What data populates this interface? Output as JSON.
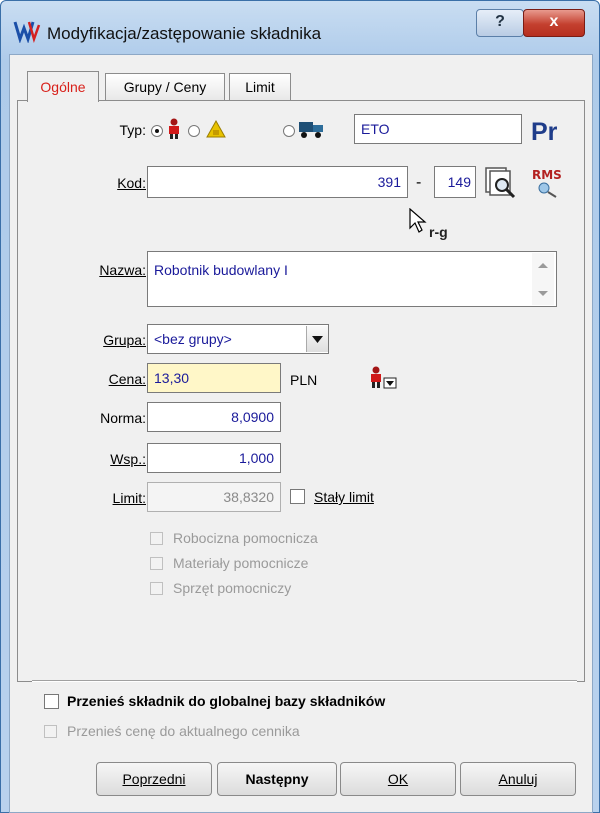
{
  "window": {
    "title": "Modyfikacja/zastępowanie składnika",
    "help": "?",
    "close": "x"
  },
  "tabs": [
    {
      "label": "Ogólne",
      "active": true
    },
    {
      "label": "Grupy / Ceny",
      "active": false
    },
    {
      "label": "Limit",
      "active": false
    }
  ],
  "form": {
    "typ_label": "Typ:",
    "typ_value": "ETO",
    "typ_badge": "Pr",
    "kod_label": "Kod:",
    "kod_main": "391",
    "kod_dash": "-",
    "kod_sub": "149",
    "rms_label": "RMS",
    "cursor_text": "r-g",
    "nazwa_label": "Nazwa:",
    "nazwa_value": "Robotnik budowlany I",
    "grupa_label": "Grupa:",
    "grupa_value": "<bez grupy>",
    "cena_label": "Cena:",
    "cena_value": "13,30",
    "currency": "PLN",
    "norma_label": "Norma:",
    "norma_value": "8,0900",
    "wsp_label": "Wsp.:",
    "wsp_value": "1,000",
    "limit_label": "Limit:",
    "limit_value": "38,8320",
    "staly_limit_label": "Stały limit",
    "robocizna_label": "Robocizna pomocnicza",
    "materialy_label": "Materiały pomocnicze",
    "sprzet_label": "Sprzęt pomocniczy"
  },
  "bottom": {
    "global_label": "Przenieś składnik do globalnej bazy składników",
    "price_label": "Przenieś cenę do aktualnego cennika"
  },
  "buttons": {
    "prev": "Poprzedni",
    "next": "Następny",
    "ok": "OK",
    "cancel": "Anuluj"
  },
  "colors": {
    "active_tab": "#d8201a",
    "value_blue": "#1a1a9a",
    "price_bg": "#fff7c8",
    "close_red": "#c4402f"
  }
}
